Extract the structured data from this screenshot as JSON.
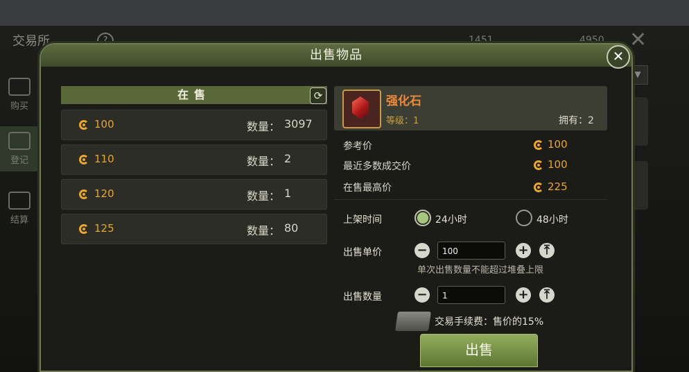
{
  "background": {
    "title": "交易所",
    "help": "?",
    "currency_a": "1451",
    "currency_b": "4950",
    "tabs": [
      "购买",
      "登记",
      "结算"
    ]
  },
  "modal": {
    "title": "出售物品",
    "close_label": "✕"
  },
  "listings": {
    "header": "在售",
    "refresh_icon": "refresh-icon",
    "qty_label": "数量：",
    "rows": [
      {
        "price": "100",
        "qty": "3097"
      },
      {
        "price": "110",
        "qty": "2"
      },
      {
        "price": "120",
        "qty": "1"
      },
      {
        "price": "125",
        "qty": "80"
      }
    ]
  },
  "item": {
    "name": "强化石",
    "level": "等级：1",
    "owned": "拥有：2"
  },
  "info": {
    "ref_label": "参考价",
    "ref_value": "100",
    "recent_label": "最近多数成交价",
    "recent_value": "100",
    "max_label": "在售最高价",
    "max_value": "225"
  },
  "form": {
    "time_label": "上架时间",
    "opt_24": "24小时",
    "opt_48": "48小时",
    "selected": "24小时",
    "price_label": "出售单价",
    "price_value": "100",
    "hint": "单次出售数量不能超过堆叠上限",
    "qty_label": "出售数量",
    "qty_value": "1",
    "minus": "−",
    "plus": "+",
    "max": "⤒",
    "fee": "交易手续费：售价的15%",
    "sell_button": "出售"
  },
  "colors": {
    "accent": "#e9a52d",
    "item_name": "#ee8a3b",
    "header_green": "#5a6839"
  }
}
